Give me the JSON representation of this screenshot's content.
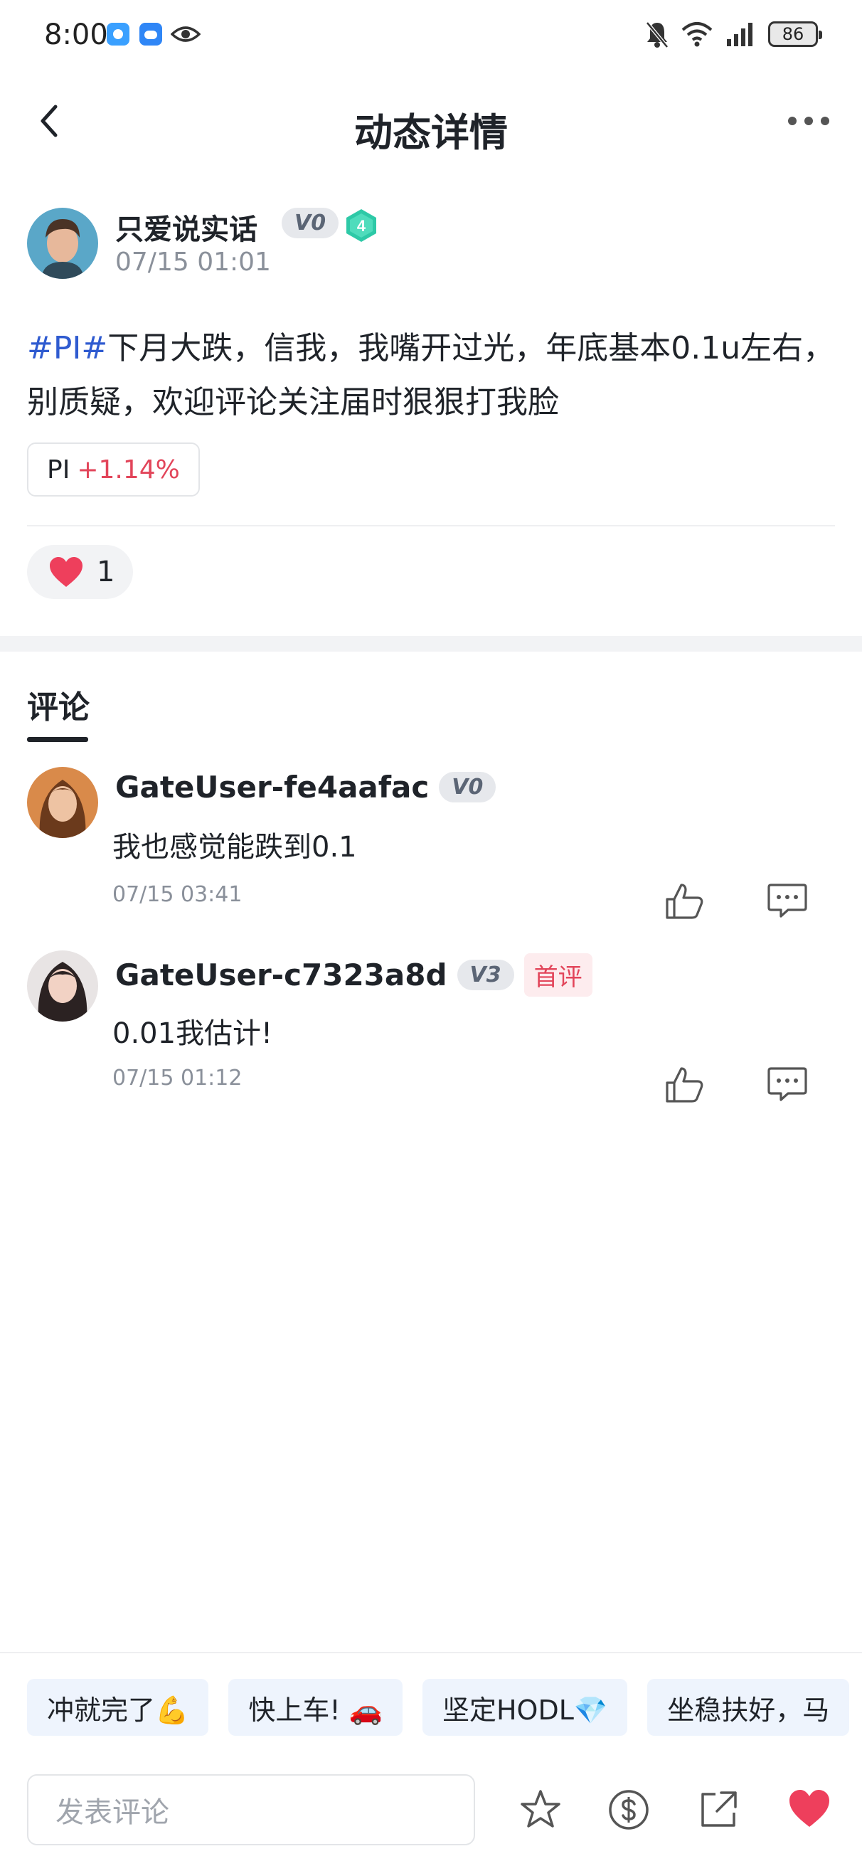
{
  "status_bar": {
    "time": "8:00",
    "battery": "86"
  },
  "header": {
    "title": "动态详情"
  },
  "post": {
    "author": "只爱说实话",
    "vip": "V0",
    "level": "4",
    "time": "07/15 01:01",
    "hashtag": "#PI#",
    "text": "下月大跌，信我，我嘴开过光，年底基本0.1u左右，别质疑，欢迎评论关注届时狠狠打我脸",
    "coin": {
      "symbol": "PI",
      "change": "+1.14%"
    },
    "likes": "1"
  },
  "comments_section": {
    "tab_label": "评论",
    "items": [
      {
        "name": "GateUser-fe4aafac",
        "vip": "V0",
        "text": "我也感觉能跌到0.1",
        "time": "07/15 03:41",
        "first_label": ""
      },
      {
        "name": "GateUser-c7323a8d",
        "vip": "V3",
        "text": "0.01我估计!",
        "time": "07/15 01:12",
        "first_label": "首评"
      }
    ]
  },
  "quick_replies": [
    "冲就完了💪",
    "快上车! 🚗",
    "坚定HODL💎",
    "坐稳扶好，马"
  ],
  "composer": {
    "placeholder": "发表评论"
  },
  "colors": {
    "accent_red": "#e2455a",
    "hashtag_blue": "#2f5bd0",
    "level_teal": "#2ec9a7"
  },
  "icons": [
    "back-icon",
    "more-icon",
    "heart-icon",
    "thumbs-up-icon",
    "comment-icon",
    "star-icon",
    "tip-icon",
    "share-icon"
  ]
}
